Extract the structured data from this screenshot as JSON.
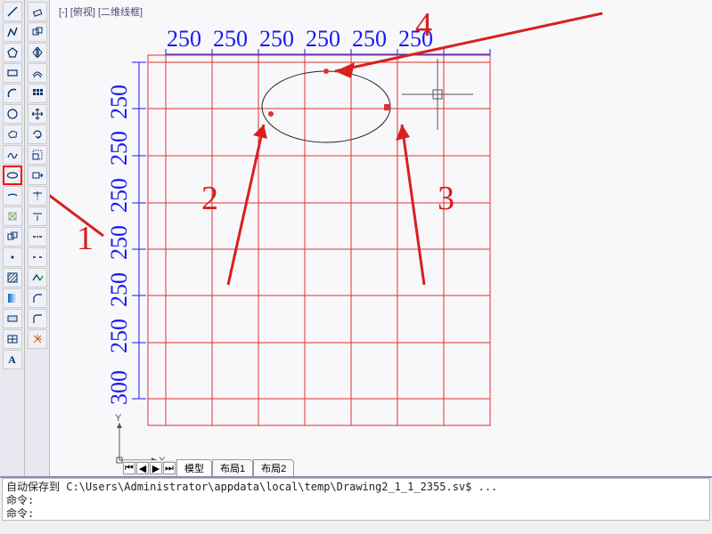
{
  "view": {
    "label": "[-] [俯视] [二维线框]"
  },
  "dims": {
    "top": [
      "250",
      "250",
      "250",
      "250",
      "250",
      "250"
    ],
    "left": [
      "300",
      "250",
      "250",
      "250",
      "250",
      "250",
      "250"
    ]
  },
  "annotations": {
    "n1": "1",
    "n2": "2",
    "n3": "3",
    "n4": "4"
  },
  "ucs": {
    "x": "X",
    "y": "Y"
  },
  "tabs": {
    "model": "模型",
    "layout1": "布局1",
    "layout2": "布局2"
  },
  "cmd": {
    "l1": "自动保存到 C:\\Users\\Administrator\\appdata\\local\\temp\\Drawing2_1_1_2355.sv$ ...",
    "l2": "命令:",
    "l3": "命令:"
  },
  "tools_left": [
    "line",
    "pline",
    "polygon",
    "rect",
    "arc",
    "circle",
    "revcloud",
    "spline",
    "ellipse",
    "ellipse-arc",
    "insert",
    "block",
    "point",
    "hatch",
    "gradient",
    "region",
    "table",
    "mtext"
  ],
  "tools_right": [
    "erase",
    "copy",
    "mirror",
    "offset",
    "array",
    "move",
    "rotate",
    "scale",
    "stretch",
    "trim",
    "extend",
    "break-at",
    "break",
    "join",
    "chamfer",
    "fillet",
    "explode"
  ]
}
